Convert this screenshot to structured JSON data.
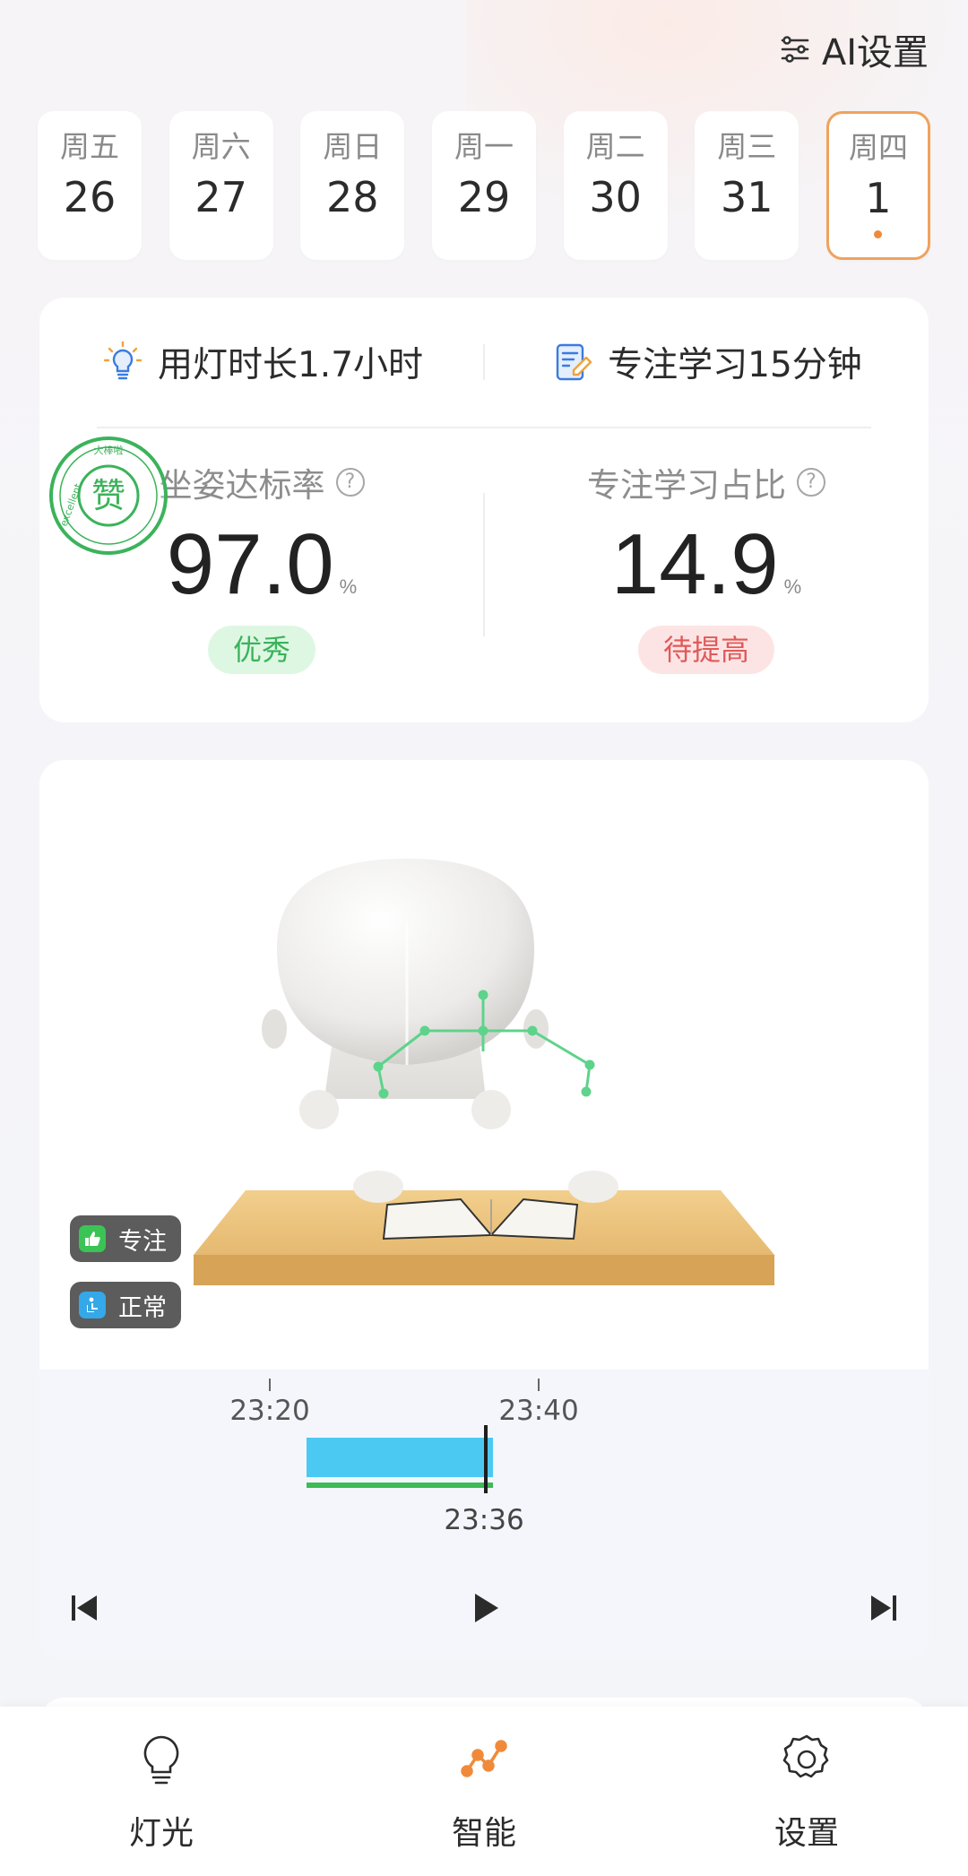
{
  "header": {
    "ai_settings_label": "AI设置"
  },
  "dates": [
    {
      "weekday": "周五",
      "day": "26",
      "active": false
    },
    {
      "weekday": "周六",
      "day": "27",
      "active": false
    },
    {
      "weekday": "周日",
      "day": "28",
      "active": false
    },
    {
      "weekday": "周一",
      "day": "29",
      "active": false
    },
    {
      "weekday": "周二",
      "day": "30",
      "active": false
    },
    {
      "weekday": "周三",
      "day": "31",
      "active": false
    },
    {
      "weekday": "周四",
      "day": "1",
      "active": true
    }
  ],
  "summary": {
    "lamp_usage": "用灯时长1.7小时",
    "focus_study": "专注学习15分钟",
    "posture": {
      "label": "坐姿达标率",
      "value": "97.0",
      "unit": "%",
      "badge": "优秀"
    },
    "focus_ratio": {
      "label": "专注学习占比",
      "value": "14.9",
      "unit": "%",
      "badge": "待提高"
    },
    "stamp": {
      "char": "赞",
      "ring_text_top": "大棒啦",
      "ring_text_left": "excellent"
    }
  },
  "replay": {
    "status_focus": "专注",
    "status_posture": "正常",
    "ticks": [
      "23:20",
      "23:40"
    ],
    "current_time": "23:36"
  },
  "tabbar": [
    {
      "label": "灯光",
      "icon": "bulb-icon"
    },
    {
      "label": "智能",
      "icon": "smart-chart-icon"
    },
    {
      "label": "设置",
      "icon": "gear-icon"
    }
  ],
  "colors": {
    "accent_orange": "#ee8a3a",
    "good_green": "#3bb35a",
    "warn_red": "#e05a5a",
    "timeline_blue": "#4cc9f3"
  }
}
